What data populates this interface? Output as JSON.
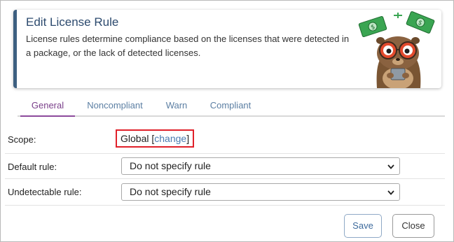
{
  "banner": {
    "title": "Edit License Rule",
    "description": "License rules determine compliance based on the licenses that were detected in a package, or the lack of detected licenses."
  },
  "tabs": [
    {
      "label": "General",
      "active": true
    },
    {
      "label": "Noncompliant",
      "active": false
    },
    {
      "label": "Warn",
      "active": false
    },
    {
      "label": "Compliant",
      "active": false
    }
  ],
  "form": {
    "scope": {
      "label": "Scope:",
      "value": "Global",
      "change_link": "change"
    },
    "default_rule": {
      "label": "Default rule:",
      "selected": "Do not specify rule"
    },
    "undetectable_rule": {
      "label": "Undetectable rule:",
      "selected": "Do not specify rule"
    }
  },
  "buttons": {
    "save": "Save",
    "close": "Close"
  },
  "colors": {
    "banner_accent": "#3d5f80",
    "active_tab": "#8c4a9c",
    "tab_text": "#5c7fa3",
    "highlight_box": "#e0202a",
    "link": "#4a7ab0"
  },
  "icons": [
    "mascot-illustration",
    "money-icon",
    "chevron-down-icon"
  ]
}
